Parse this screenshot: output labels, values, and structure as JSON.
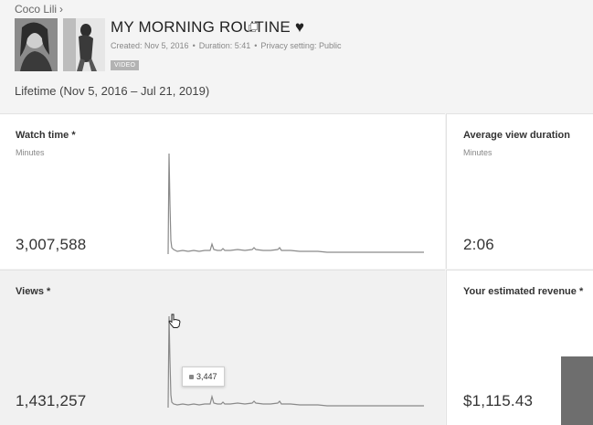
{
  "breadcrumb": {
    "channel": "Coco Lili",
    "chevron": "›"
  },
  "video": {
    "title": "MY MORNING ROUTINE ♥",
    "created": "Created: Nov 5, 2016",
    "duration": "Duration: 5:41",
    "privacy": "Privacy setting: Public",
    "separator": "•",
    "badge": "VIDEO"
  },
  "period": "Lifetime (Nov 5, 2016 – Jul 21, 2019)",
  "metrics": {
    "watch_time": {
      "title": "Watch time *",
      "unit": "Minutes",
      "value": "3,007,588"
    },
    "avg_view_duration": {
      "title": "Average view duration",
      "unit": "Minutes",
      "value": "2:06"
    },
    "views": {
      "title": "Views *",
      "value": "1,431,257",
      "tooltip": "3,447"
    },
    "revenue": {
      "title": "Your estimated revenue *",
      "value": "$1,115.43"
    }
  },
  "icons": {
    "external_link": "external-link-icon",
    "cursor": "hand-pointer-icon"
  },
  "colors": {
    "sparkline": "#8a8a8a",
    "badge": "#b3b3b3"
  }
}
